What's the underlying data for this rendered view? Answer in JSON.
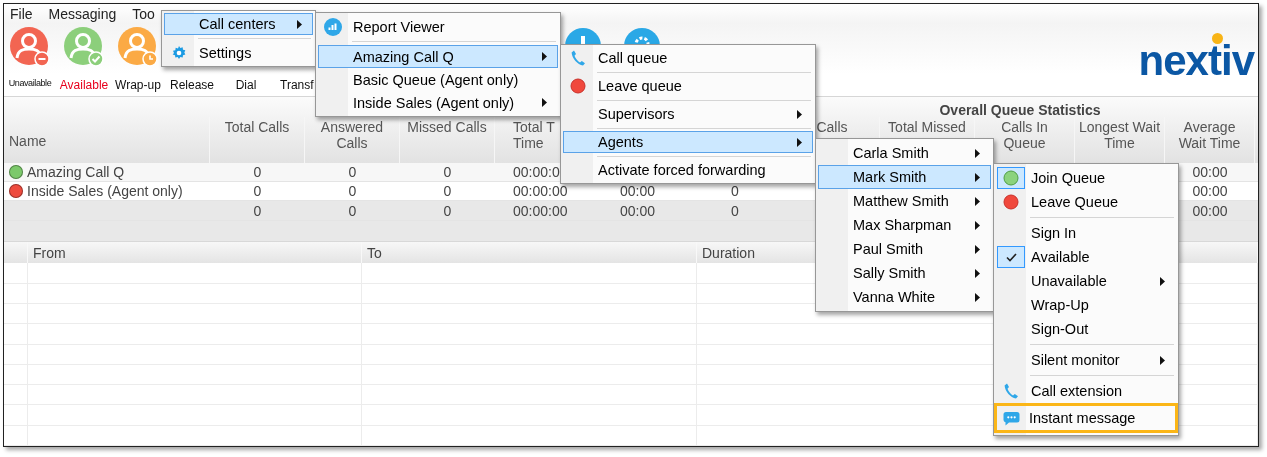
{
  "menu_bar": [
    {
      "label": "File"
    },
    {
      "label": "Messaging"
    },
    {
      "label": "Too"
    }
  ],
  "toolbar": {
    "buttons": [
      {
        "label": "Unavailable",
        "kind": "unavailable",
        "selected": false
      },
      {
        "label": "Available",
        "kind": "available",
        "selected": true
      },
      {
        "label": "Wrap-up",
        "kind": "wrapup",
        "selected": false
      },
      {
        "label": "Release",
        "kind": "action",
        "selected": false
      },
      {
        "label": "Dial",
        "kind": "action",
        "selected": false
      },
      {
        "label": "Transf",
        "kind": "action",
        "selected": false
      }
    ]
  },
  "logo": "nextiv",
  "queue_stats": {
    "group_header": "Overall Queue Statistics",
    "columns": {
      "name": "Name",
      "total_calls": "Total Calls",
      "answered_calls": "Answered\nCalls",
      "missed_calls": "Missed Calls",
      "column_5": "Total T\nTime",
      "column_8": "Calls",
      "total_missed": "Total Missed",
      "calls_in_queue": "Calls In\nQueue",
      "longest_wait_time": "Longest Wait\nTime",
      "average_wait_time": "Average\nWait Time"
    },
    "rows": [
      {
        "color": "#7cc96b",
        "name": "Amazing Call Q",
        "total_calls": "0",
        "answered_calls": "0",
        "missed_calls": "0",
        "column_5": "00:00:0",
        "average_wait_time": "00:00"
      },
      {
        "color": "#ee4b3e",
        "name": "Inside Sales (Agent only)",
        "total_calls": "0",
        "answered_calls": "0",
        "missed_calls": "0",
        "column_5": "00:00:00",
        "column_6": "00:00",
        "column_7": "0",
        "average_wait_time": "00:00"
      }
    ],
    "totals": {
      "total_calls": "0",
      "answered_calls": "0",
      "missed_calls": "0",
      "column_5": "00:00:00",
      "column_6": "00:00",
      "column_7": "0",
      "average_wait_time": "00:00"
    }
  },
  "call_log": {
    "columns": [
      "From",
      "To",
      "Duration"
    ]
  },
  "menus": [
    {
      "items": [
        {
          "kind": "item",
          "label": "Call centers",
          "selected": true,
          "submenu": true
        },
        {
          "kind": "separator"
        },
        {
          "kind": "item",
          "label": "Settings",
          "selected": false,
          "submenu": false
        }
      ]
    },
    {
      "items": [
        {
          "kind": "item",
          "label": "Report Viewer",
          "selected": false,
          "submenu": false
        },
        {
          "kind": "separator"
        },
        {
          "kind": "item",
          "label": "Amazing Call Q",
          "selected": true,
          "submenu": true
        },
        {
          "kind": "item",
          "label": "Basic Queue (Agent only)",
          "selected": false,
          "submenu": false
        },
        {
          "kind": "item",
          "label": "Inside Sales (Agent only)",
          "selected": false,
          "submenu": true
        }
      ]
    },
    {
      "items": [
        {
          "kind": "item",
          "label": "Call queue",
          "selected": false,
          "submenu": false
        },
        {
          "kind": "separator"
        },
        {
          "kind": "item",
          "label": "Leave queue",
          "selected": false,
          "submenu": false
        },
        {
          "kind": "separator"
        },
        {
          "kind": "item",
          "label": "Supervisors",
          "selected": false,
          "submenu": true
        },
        {
          "kind": "separator"
        },
        {
          "kind": "item",
          "label": "Agents",
          "selected": true,
          "submenu": true
        },
        {
          "kind": "separator"
        },
        {
          "kind": "item",
          "label": "Activate forced forwarding",
          "selected": false,
          "submenu": false
        }
      ]
    },
    {
      "items": [
        {
          "kind": "item",
          "label": "Carla Smith",
          "selected": false,
          "submenu": true
        },
        {
          "kind": "item",
          "label": "Mark Smith",
          "selected": true,
          "submenu": true
        },
        {
          "kind": "item",
          "label": "Matthew Smith",
          "selected": false,
          "submenu": true
        },
        {
          "kind": "item",
          "label": "Max Sharpman",
          "selected": false,
          "submenu": true
        },
        {
          "kind": "item",
          "label": "Paul Smith",
          "selected": false,
          "submenu": true
        },
        {
          "kind": "item",
          "label": "Sally Smith",
          "selected": false,
          "submenu": true
        },
        {
          "kind": "item",
          "label": "Vanna White",
          "selected": false,
          "submenu": true
        }
      ]
    },
    {
      "items": [
        {
          "kind": "item",
          "label": "Join Queue",
          "checked": true,
          "selected": false,
          "submenu": false,
          "outlined": false
        },
        {
          "kind": "item",
          "label": "Leave Queue",
          "checked": false,
          "selected": false,
          "submenu": false,
          "outlined": false
        },
        {
          "kind": "separator"
        },
        {
          "kind": "item",
          "label": "Sign In",
          "checked": false,
          "selected": false,
          "submenu": false,
          "outlined": false
        },
        {
          "kind": "item",
          "label": "Available",
          "checked": true,
          "selected": false,
          "submenu": false,
          "outlined": false
        },
        {
          "kind": "item",
          "label": "Unavailable",
          "checked": false,
          "selected": false,
          "submenu": true,
          "outlined": false
        },
        {
          "kind": "item",
          "label": "Wrap-Up",
          "checked": false,
          "selected": false,
          "submenu": false,
          "outlined": false
        },
        {
          "kind": "item",
          "label": "Sign-Out",
          "checked": false,
          "selected": false,
          "submenu": false,
          "outlined": false
        },
        {
          "kind": "separator"
        },
        {
          "kind": "item",
          "label": "Silent monitor",
          "checked": false,
          "selected": false,
          "submenu": true,
          "outlined": false
        },
        {
          "kind": "separator"
        },
        {
          "kind": "item",
          "label": "Call extension",
          "checked": false,
          "selected": false,
          "submenu": false,
          "outlined": false
        },
        {
          "kind": "item",
          "label": "Instant message",
          "checked": false,
          "selected": false,
          "submenu": false,
          "outlined": true
        }
      ]
    }
  ]
}
